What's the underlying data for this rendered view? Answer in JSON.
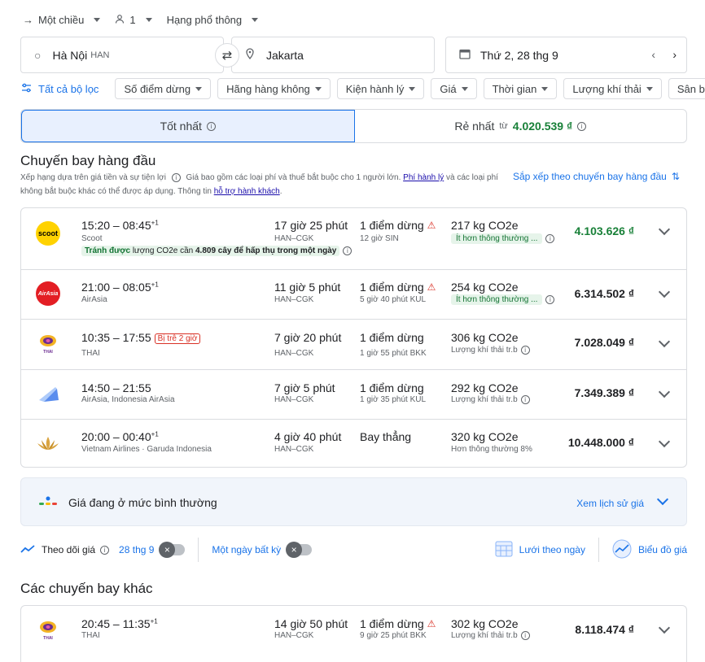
{
  "topbar": {
    "trip": "Một chiều",
    "pax": "1",
    "cabin": "Hạng phổ thông"
  },
  "search": {
    "origin": "Hà Nội",
    "origin_code": "HAN",
    "destination": "Jakarta",
    "date": "Thứ 2, 28 thg 9"
  },
  "filters": {
    "all": "Tất cả bộ lọc",
    "chips": [
      "Số điểm dừng",
      "Hãng hàng không",
      "Kiện hành lý",
      "Giá",
      "Thời gian",
      "Lượng khí thải",
      "Sân bay n"
    ]
  },
  "tabs": {
    "best": "Tốt nhất",
    "cheap": "Rẻ nhất",
    "from": "từ",
    "cheap_price": "4.020.539 ₫"
  },
  "top_header": "Chuyến bay hàng đầu",
  "sub": {
    "a": "Xếp hạng dựa trên giá tiền và sự tiện lợi",
    "b": "Giá bao gồm các loại phí và thuế bắt buộc cho 1 người lớn.",
    "c": "Phí hành lý",
    "d": "và các loại phí không bắt buộc khác có thể được áp dụng. Thông tin",
    "e": "hỗ trợ hành khách",
    "f": "."
  },
  "sort_label": "Sắp xếp theo chuyến bay hàng đầu",
  "flights": [
    {
      "time": "15:20 – 08:45",
      "plus": "+1",
      "airline": "Scoot",
      "dur": "17 giờ 25 phút",
      "route": "HAN–CGK",
      "stops": "1 điểm dừng",
      "stop_detail": "12 giờ SIN",
      "co2": "217 kg CO2e",
      "co2_detail": "Ít hơn thông thường ...",
      "price": "4.103.626 ₫",
      "save_a": "Tránh được",
      "save_b": "lượng CO2e cần",
      "save_c": "4.809 cây để hấp thụ trong một ngày"
    },
    {
      "time": "21:00 – 08:05",
      "plus": "+1",
      "airline": "AirAsia",
      "dur": "11 giờ 5 phút",
      "route": "HAN–CGK",
      "stops": "1 điểm dừng",
      "stop_detail": "5 giờ 40 phút KUL",
      "co2": "254 kg CO2e",
      "co2_detail": "Ít hơn thông thường ...",
      "price": "6.314.502 ₫"
    },
    {
      "time": "10:35 – 17:55",
      "delay": "Bị trễ 2 giờ",
      "airline": "THAI",
      "dur": "7 giờ 20 phút",
      "route": "HAN–CGK",
      "stops": "1 điểm dừng",
      "stop_detail": "1 giờ 55 phút BKK",
      "co2": "306 kg CO2e",
      "co2_detail": "Lượng khí thải tr.b",
      "price": "7.028.049 ₫"
    },
    {
      "time": "14:50 – 21:55",
      "airline": "AirAsia, Indonesia AirAsia",
      "dur": "7 giờ 5 phút",
      "route": "HAN–CGK",
      "stops": "1 điểm dừng",
      "stop_detail": "1 giờ 35 phút KUL",
      "co2": "292 kg CO2e",
      "co2_detail": "Lượng khí thải tr.b",
      "price": "7.349.389 ₫"
    },
    {
      "time": "20:00 – 00:40",
      "plus": "+1",
      "airline": "Vietnam Airlines · Garuda Indonesia",
      "dur": "4 giờ 40 phút",
      "route": "HAN–CGK",
      "stops": "Bay thẳng",
      "co2": "320 kg CO2e",
      "co2_detail": "Hơn thông thường 8%",
      "price": "10.448.000 ₫"
    }
  ],
  "price_info": {
    "a": "Giá đang ở mức",
    "b": "bình thường",
    "link": "Xem lịch sử giá"
  },
  "track": {
    "label": "Theo dõi giá",
    "date": "28 thg 9",
    "any": "Một ngày bất kỳ",
    "grid": "Lưới theo ngày",
    "graph": "Biểu đồ giá"
  },
  "other_header": "Các chuyến bay khác",
  "other": [
    {
      "time": "20:45 – 11:35",
      "plus": "+1",
      "airline": "THAI",
      "dur": "14 giờ 50 phút",
      "route": "HAN–CGK",
      "stops": "1 điểm dừng",
      "stop_detail": "9 giờ 25 phút BKK",
      "co2": "302 kg CO2e",
      "co2_detail": "Lượng khí thải tr.b",
      "price": "8.118.474 ₫"
    }
  ],
  "logos": {
    "scoot": "scoot",
    "airasia": "AirAsia",
    "thai": "THAI"
  },
  "colors": {
    "accent": "#1a73e8",
    "green": "#188038",
    "warn": "#d93025"
  }
}
